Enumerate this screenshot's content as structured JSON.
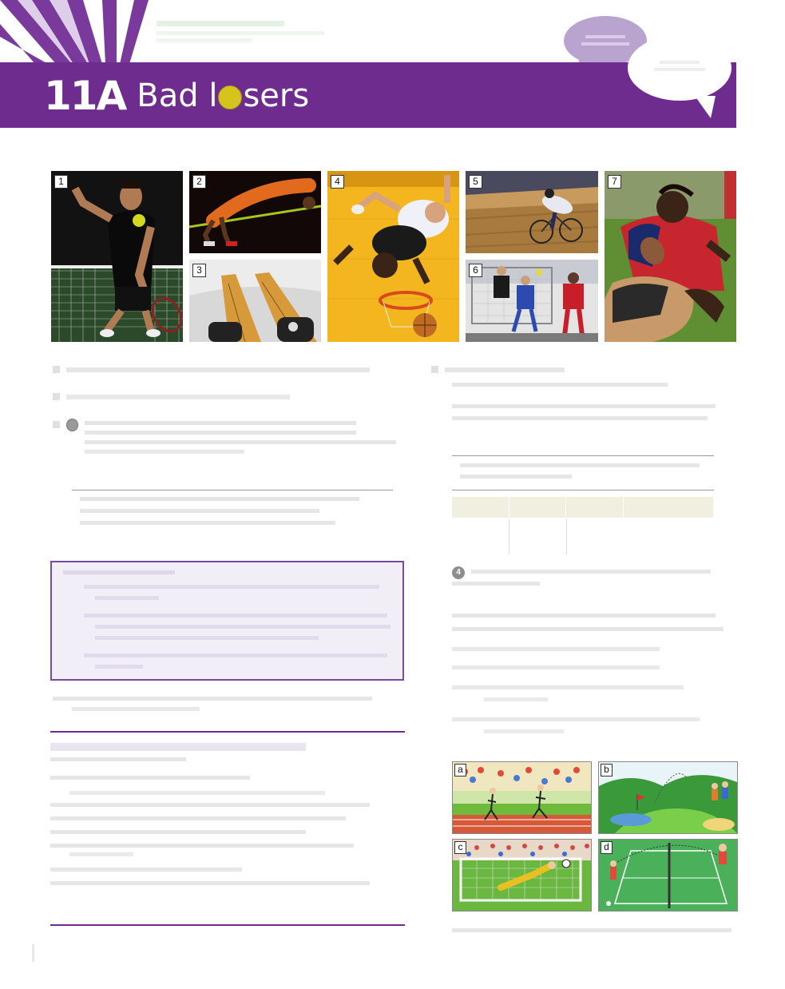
{
  "header": {
    "unit_number": "11A",
    "title_part1": "Bad l",
    "title_part2": "sers",
    "ball_icon": "tennis-ball-icon",
    "banner_color": "#6f2c8f"
  },
  "photos": [
    {
      "label": "1",
      "sport": "tennis"
    },
    {
      "label": "2",
      "sport": "high jump"
    },
    {
      "label": "3",
      "sport": "skiing"
    },
    {
      "label": "4",
      "sport": "basketball"
    },
    {
      "label": "5",
      "sport": "cycling"
    },
    {
      "label": "6",
      "sport": "handball"
    },
    {
      "label": "7",
      "sport": "rugby"
    }
  ],
  "illustrations": [
    {
      "label": "a",
      "scene": "running race"
    },
    {
      "label": "b",
      "scene": "golf course"
    },
    {
      "label": "c",
      "scene": "football goal"
    },
    {
      "label": "d",
      "scene": "tennis court"
    }
  ],
  "audio_track": "4"
}
